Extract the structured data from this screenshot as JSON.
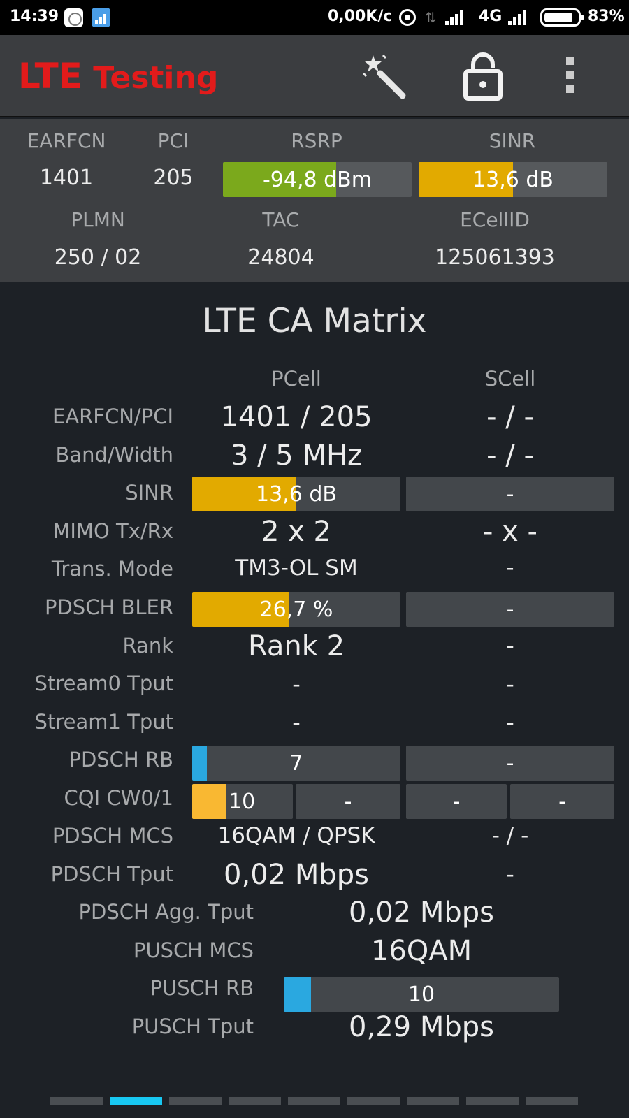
{
  "status_bar": {
    "time": "14:39",
    "net_speed": "0,00K/c",
    "network_type": "4G",
    "battery": "83%",
    "icons": [
      "mi-app-icon",
      "signal-app-icon",
      "hotspot-icon",
      "data-arrows-icon",
      "signal-icon",
      "signal-icon",
      "battery-icon"
    ]
  },
  "app_bar": {
    "title_part1": "LTE",
    "title_part2": "Testing",
    "title_color": "#e21b1b",
    "icons": [
      "magic-wand-icon",
      "unlock-icon",
      "more-vert-icon"
    ]
  },
  "serving_cell": {
    "labels": {
      "earfcn": "EARFCN",
      "pci": "PCI",
      "rsrp": "RSRP",
      "sinr": "SINR",
      "plmn": "PLMN",
      "tac": "TAC",
      "ecellid": "ECellID"
    },
    "earfcn": "1401",
    "pci": "205",
    "rsrp": {
      "text": "-94,8 dBm",
      "level": 0.6,
      "color": "#7ba91c"
    },
    "sinr": {
      "text": "13,6 dB",
      "level": 0.5,
      "color": "#e2aa00"
    },
    "plmn": "250 / 02",
    "tac": "24804",
    "ecellid": "125061393"
  },
  "matrix": {
    "title": "LTE CA Matrix",
    "col_pcell": "PCell",
    "col_scell": "SCell",
    "rows": {
      "earfcn_pci": {
        "label": "EARFCN/PCI",
        "pcell": "1401 / 205",
        "scell": "- / -"
      },
      "band_width": {
        "label": "Band/Width",
        "pcell": "3 / 5 MHz",
        "scell": "- / -"
      },
      "sinr": {
        "label": "SINR",
        "pcell": "13,6 dB",
        "pcell_level": 0.5,
        "pcell_color": "#e2aa00",
        "scell": "-"
      },
      "mimo": {
        "label": "MIMO Tx/Rx",
        "pcell": "2 x 2",
        "scell": "- x -"
      },
      "trans_mode": {
        "label": "Trans. Mode",
        "pcell": "TM3-OL SM",
        "scell": "-"
      },
      "bler": {
        "label": "PDSCH BLER",
        "pcell": "26,7 %",
        "pcell_level": 0.467,
        "pcell_color": "#e2aa00",
        "scell": "-"
      },
      "rank": {
        "label": "Rank",
        "pcell": "Rank 2",
        "scell": "-"
      },
      "stream0": {
        "label": "Stream0 Tput",
        "pcell": "-",
        "scell": "-"
      },
      "stream1": {
        "label": "Stream1 Tput",
        "pcell": "-",
        "scell": "-"
      },
      "pdsch_rb": {
        "label": "PDSCH RB",
        "pcell": "7",
        "pcell_level": 0.07,
        "pcell_color": "#2aa8e0",
        "scell": "-"
      },
      "cqi": {
        "label": "CQI CW0/1",
        "pcell_cw0": "10",
        "pcell_cw0_level": 0.33,
        "pcell_cw0_color": "#f9b832",
        "pcell_cw1": "-",
        "scell_cw0": "-",
        "scell_cw1": "-"
      },
      "pdsch_mcs": {
        "label": "PDSCH MCS",
        "pcell": "16QAM / QPSK",
        "scell": "- / -"
      },
      "pdsch_tput": {
        "label": "PDSCH Tput",
        "pcell": "0,02 Mbps",
        "scell": "-"
      }
    },
    "aggregate": {
      "agg_tput": {
        "label": "PDSCH Agg. Tput",
        "value": "0,02 Mbps"
      },
      "pusch_mcs": {
        "label": "PUSCH MCS",
        "value": "16QAM"
      },
      "pusch_rb": {
        "label": "PUSCH RB",
        "value": "10",
        "level": 0.1,
        "color": "#2aa8e0"
      },
      "pusch_tput": {
        "label": "PUSCH Tput",
        "value": "0,29 Mbps"
      }
    }
  },
  "pager": {
    "page_count": 9,
    "active_index": 1,
    "active_color": "#18c8f2"
  }
}
